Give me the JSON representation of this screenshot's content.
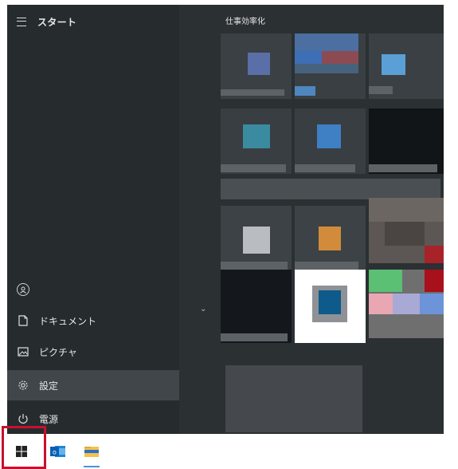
{
  "start_menu": {
    "title": "スタート",
    "group_title": "仕事効率化",
    "rail": {
      "documents": "ドキュメント",
      "pictures": "ピクチャ",
      "settings": "設定",
      "power": "電源"
    }
  },
  "colors": {
    "panel": "#2b3033",
    "rail": "#262b2e",
    "active_item": "#41464a",
    "highlight": "#c8102e",
    "windows_blue": "#0078d4"
  },
  "icons": {
    "menu": "hamburger-icon",
    "user": "user-icon",
    "documents": "document-icon",
    "pictures": "picture-icon",
    "settings": "gear-icon",
    "power": "power-icon",
    "start": "windows-logo-icon",
    "outlook": "outlook-icon",
    "explorer": "folder-icon"
  }
}
